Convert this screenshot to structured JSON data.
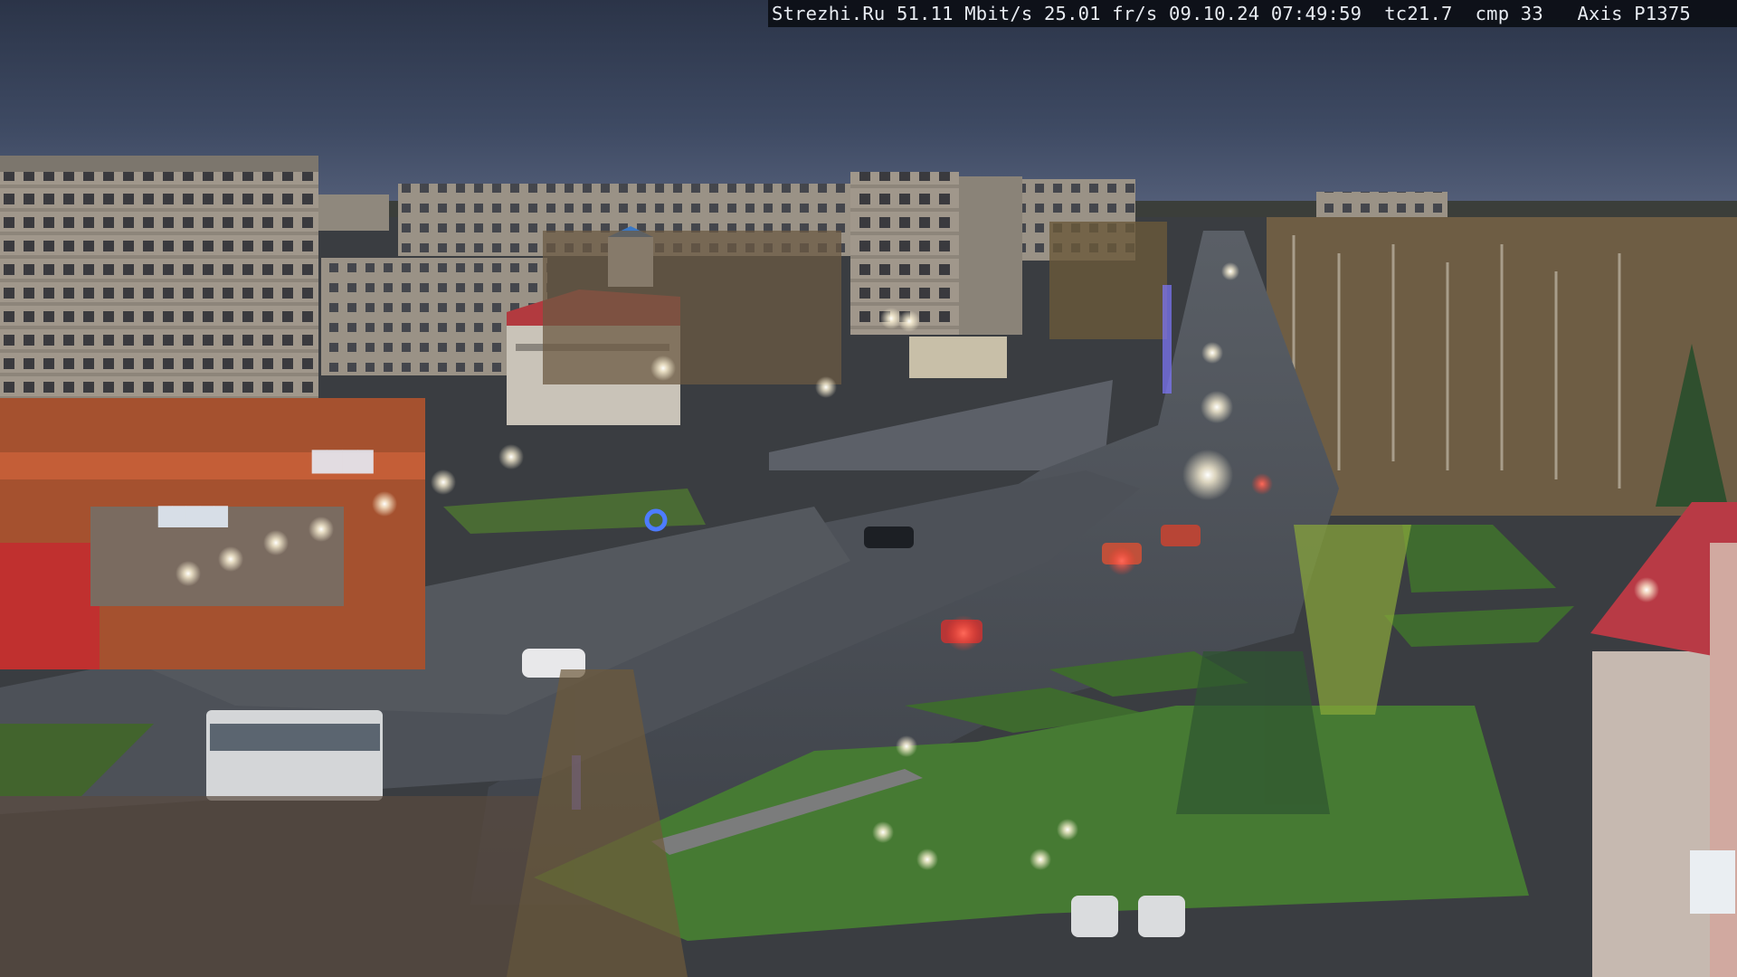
{
  "overlay": {
    "text": "Strezhi.Ru 51.11 Mbit/s 25.01 fr/s 09.10.24 07:49:59  tc21.7  cmp 33   Axis P1375",
    "background": "#0b0d13",
    "color": "#e8ecf2"
  },
  "scene": {
    "description_icon": "webcam-view",
    "colors": {
      "sky": "#3d4a62",
      "road": "#4a4f57",
      "grass": "#3f6b2f",
      "building_panel": "#a49a8e",
      "shop_facade": "#a5512f",
      "red_roof": "#b83a45"
    }
  }
}
